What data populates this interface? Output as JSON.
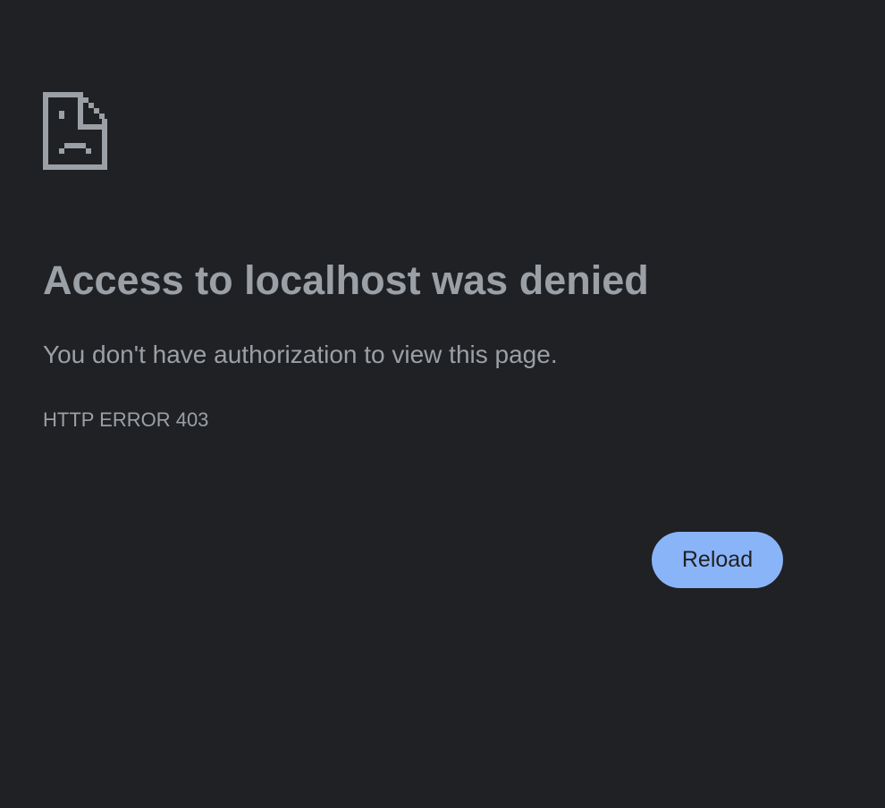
{
  "error": {
    "icon": "sad-document-icon",
    "title": "Access to localhost was denied",
    "description": "You don't have authorization to view this page.",
    "code": "HTTP ERROR 403"
  },
  "actions": {
    "reload_label": "Reload"
  },
  "colors": {
    "background": "#202124",
    "text_primary": "#9aa0a6",
    "text_secondary": "#9aa0a6",
    "icon": "#9aa0a6",
    "button_bg": "#8ab4f8",
    "button_text": "#202124"
  }
}
